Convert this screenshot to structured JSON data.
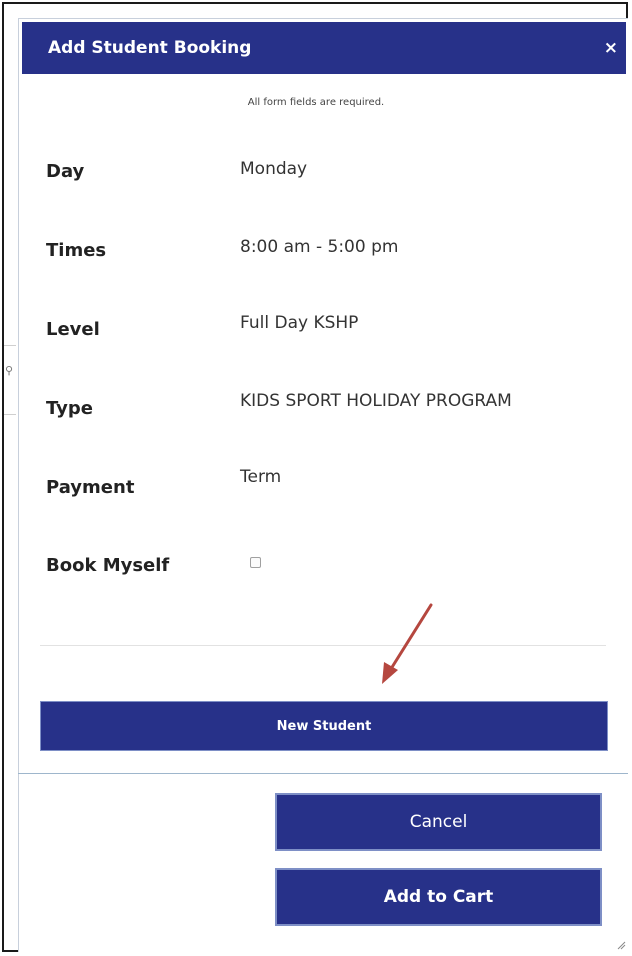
{
  "dialog": {
    "title": "Add Student Booking",
    "close_label": "×",
    "required_note": "All form fields are required."
  },
  "fields": [
    {
      "label": "Day",
      "value": "Monday"
    },
    {
      "label": "Times",
      "value": "8:00 am - 5:00 pm"
    },
    {
      "label": "Level",
      "value": "Full Day KSHP"
    },
    {
      "label": "Type",
      "value": "KIDS SPORT HOLIDAY PROGRAM"
    },
    {
      "label": "Payment",
      "value": "Term"
    },
    {
      "label": "Book Myself",
      "checked": false
    }
  ],
  "buttons": {
    "new_student": "New Student",
    "cancel": "Cancel",
    "add_to_cart": "Add to Cart"
  },
  "colors": {
    "primary": "#273189",
    "annotation_arrow": "#b5473f"
  }
}
